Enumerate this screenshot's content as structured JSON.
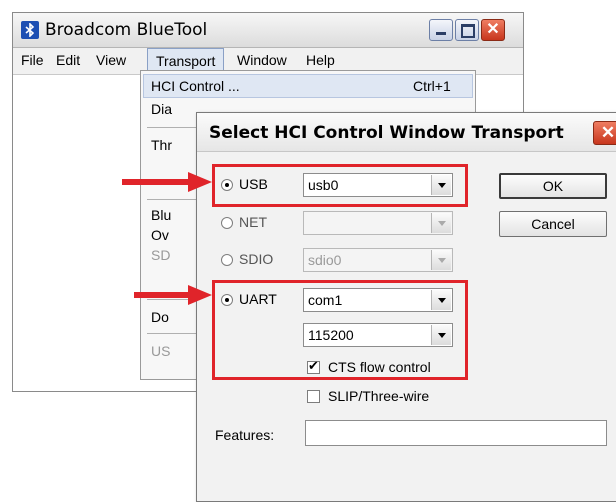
{
  "window": {
    "title": "Broadcom BlueTool",
    "close_glyph": "✕"
  },
  "menu": {
    "file": "File",
    "edit": "Edit",
    "view": "View",
    "transport": "Transport",
    "window": "Window",
    "help": "Help"
  },
  "transport_menu": {
    "items": [
      "HCI Control ...",
      "Dia",
      "Thr",
      "Blu",
      "Ov",
      "SD",
      "Do",
      "US"
    ],
    "shortcut": "Ctrl+1"
  },
  "dialog": {
    "title": "Select HCI Control Window Transport",
    "close_glyph": "✕",
    "usb": {
      "label": "USB",
      "value": "usb0",
      "selected": true
    },
    "net": {
      "label": "NET",
      "value": "",
      "selected": false
    },
    "sdio": {
      "label": "SDIO",
      "value": "sdio0",
      "selected": false
    },
    "uart": {
      "label": "UART",
      "port": "com1",
      "baud": "115200",
      "selected": true
    },
    "cts_flow": {
      "label": "CTS flow control",
      "checked": true,
      "tick": "✔"
    },
    "slip": {
      "label": "SLIP/Three-wire",
      "checked": false
    },
    "features_label": "Features:",
    "features_value": "",
    "ok_label": "OK",
    "cancel_label": "Cancel"
  },
  "colors": {
    "annotation_red": "#e0242a",
    "menu_highlight": "#dfe7f3"
  }
}
